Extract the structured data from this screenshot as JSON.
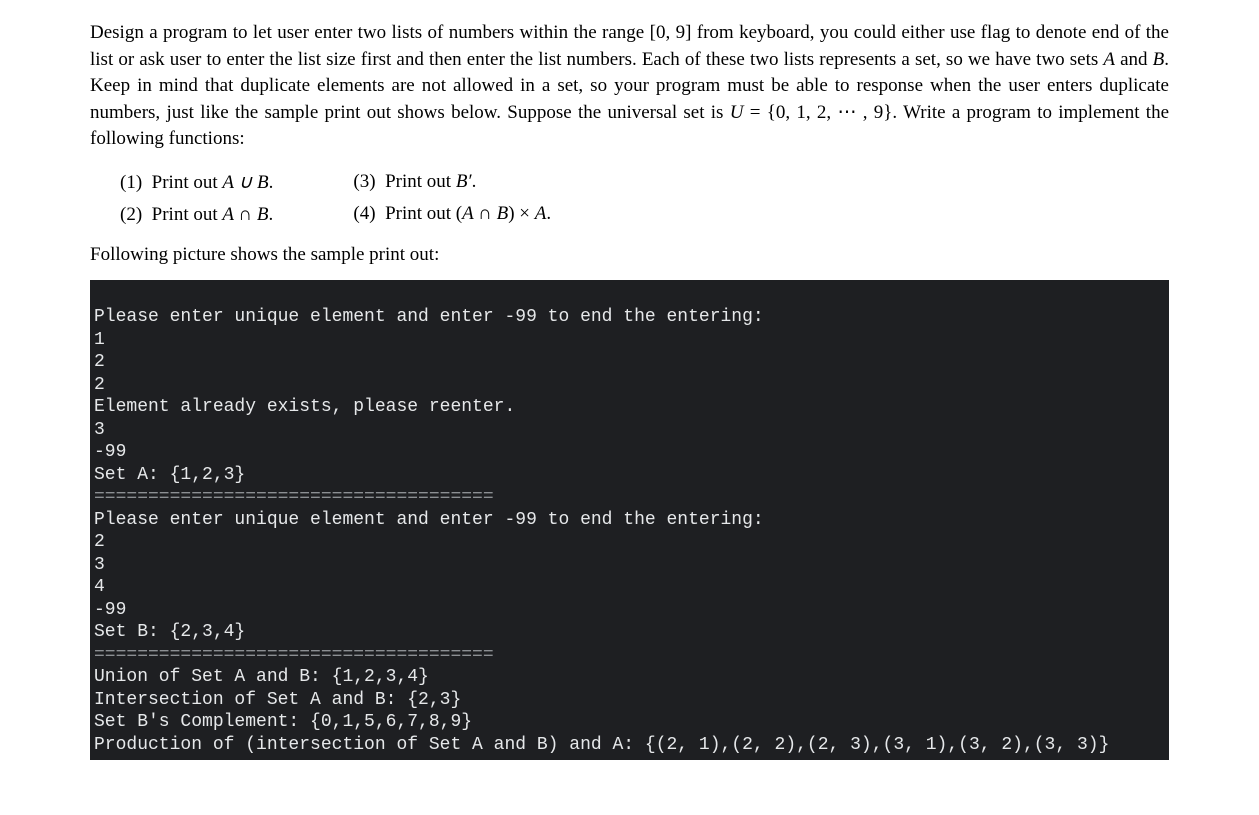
{
  "problem": {
    "paragraph_parts": {
      "p1": "Design a program to let user enter two lists of numbers within the range [0, 9] from keyboard, you could either use flag to denote end of the list or ask user to enter the list size first and then enter the list numbers. Each of these two lists represents a set, so we have two sets ",
      "p2": " and ",
      "p3": ". Keep in mind that duplicate elements are not allowed in a set, so your program must be able to response when the user enters duplicate numbers, just like the sample print out shows below. Suppose the universal set is ",
      "p4": " = {0, 1, 2, ⋯ , 9}. Write a program to implement the following functions:"
    },
    "set_A": "A",
    "set_B": "B",
    "set_U": "U"
  },
  "tasks": {
    "t1_num": "(1)",
    "t1_text": "Print out ",
    "t1_expr": "A ∪ B",
    "t1_end": ".",
    "t2_num": "(2)",
    "t2_text": "Print out ",
    "t2_expr": "A ∩ B",
    "t2_end": ".",
    "t3_num": "(3)",
    "t3_text": "Print out ",
    "t3_expr": "B′",
    "t3_end": ".",
    "t4_num": "(4)",
    "t4_text": "Print out (",
    "t4_expr": "A ∩ B",
    "t4_mid": ") × ",
    "t4_A": "A",
    "t4_end": "."
  },
  "followup": "Following picture shows the sample print out:",
  "terminal": {
    "l01": "Please enter unique element and enter -99 to end the entering:",
    "l02": "1",
    "l03": "2",
    "l04": "2",
    "l05": "Element already exists, please reenter.",
    "l06": "3",
    "l07": "-99",
    "l08": "Set A: {1,2,3}",
    "l09": "=====================================",
    "l10": "Please enter unique element and enter -99 to end the entering:",
    "l11": "2",
    "l12": "3",
    "l13": "4",
    "l14": "-99",
    "l15": "Set B: {2,3,4}",
    "l16": "=====================================",
    "l17": "Union of Set A and B: {1,2,3,4}",
    "l18": "Intersection of Set A and B: {2,3}",
    "l19": "Set B's Complement: {0,1,5,6,7,8,9}",
    "l20": "Production of (intersection of Set A and B) and A: {(2, 1),(2, 2),(2, 3),(3, 1),(3, 2),(3, 3)}"
  }
}
